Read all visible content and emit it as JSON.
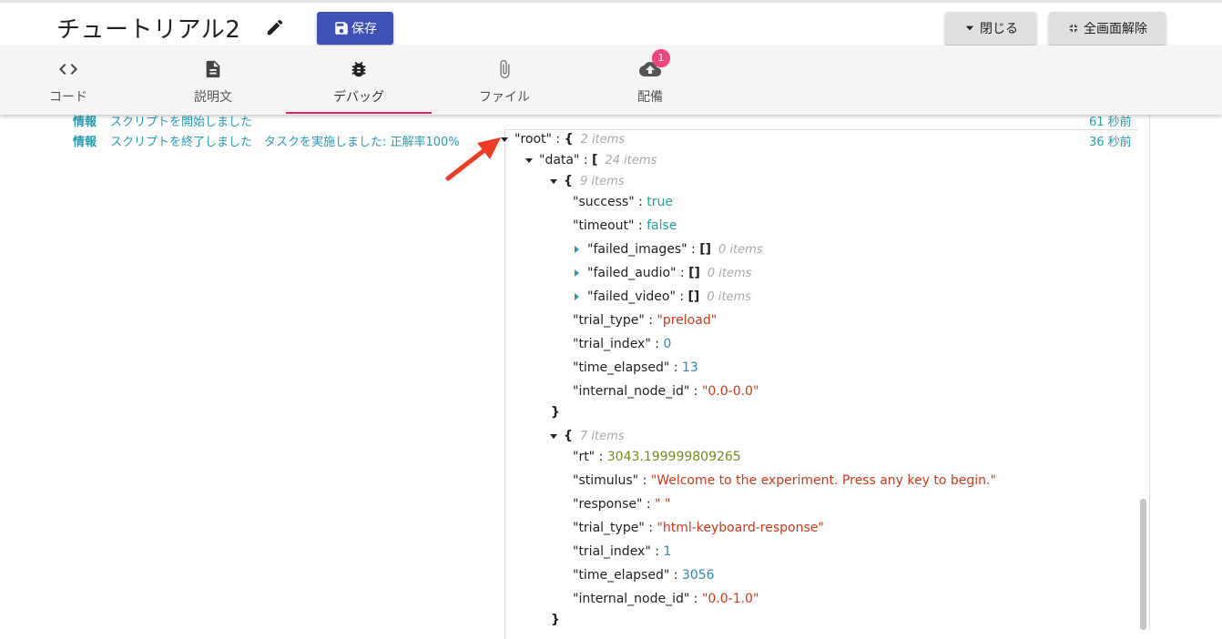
{
  "header": {
    "title": "チュートリアル2",
    "save_label": "保存",
    "close_label": "閉じる",
    "exit_fullscreen_label": "全画面解除"
  },
  "tabs": [
    {
      "label": "コード",
      "icon": "code-icon"
    },
    {
      "label": "説明文",
      "icon": "document-icon"
    },
    {
      "label": "デバッグ",
      "icon": "bug-icon",
      "active": true
    },
    {
      "label": "ファイル",
      "icon": "paperclip-icon"
    },
    {
      "label": "配備",
      "icon": "cloud-upload-icon",
      "badge": "1"
    }
  ],
  "log": [
    {
      "level": "情報",
      "message": "スクリプトを開始しました",
      "time": "61 秒前"
    },
    {
      "level": "情報",
      "message": "スクリプトを終了しました　タスクを実施しました: 正解率100%",
      "time": "36 秒前"
    }
  ],
  "json_view": {
    "root_key": "\"root\"",
    "root_count": "2 items",
    "data_key": "\"data\"",
    "data_count": "24 items",
    "obj1_count": "9 items",
    "obj1": {
      "success_key": "\"success\"",
      "success_val": "true",
      "timeout_key": "\"timeout\"",
      "timeout_val": "false",
      "failed_images_key": "\"failed_images\"",
      "failed_images_count": "0 items",
      "failed_audio_key": "\"failed_audio\"",
      "failed_audio_count": "0 items",
      "failed_video_key": "\"failed_video\"",
      "failed_video_count": "0 items",
      "trial_type_key": "\"trial_type\"",
      "trial_type_val": "\"preload\"",
      "trial_index_key": "\"trial_index\"",
      "trial_index_val": "0",
      "time_elapsed_key": "\"time_elapsed\"",
      "time_elapsed_val": "13",
      "internal_node_id_key": "\"internal_node_id\"",
      "internal_node_id_val": "\"0.0-0.0\""
    },
    "obj2_count": "7 items",
    "obj2": {
      "rt_key": "\"rt\"",
      "rt_val": "3043.199999809265",
      "stimulus_key": "\"stimulus\"",
      "stimulus_val": "\"Welcome to the experiment. Press any key to begin.\"",
      "response_key": "\"response\"",
      "response_val": "\" \"",
      "trial_type_key": "\"trial_type\"",
      "trial_type_val": "\"html-keyboard-response\"",
      "trial_index_key": "\"trial_index\"",
      "trial_index_val": "1",
      "time_elapsed_key": "\"time_elapsed\"",
      "time_elapsed_val": "3056",
      "internal_node_id_key": "\"internal_node_id\"",
      "internal_node_id_val": "\"0.0-1.0\""
    }
  },
  "colors": {
    "accent": "#3f51b5",
    "tab_indicator": "#e91e63",
    "badge": "#f0447e",
    "log_text": "#2a9bb0",
    "annotation_arrow": "#ef3b24"
  }
}
